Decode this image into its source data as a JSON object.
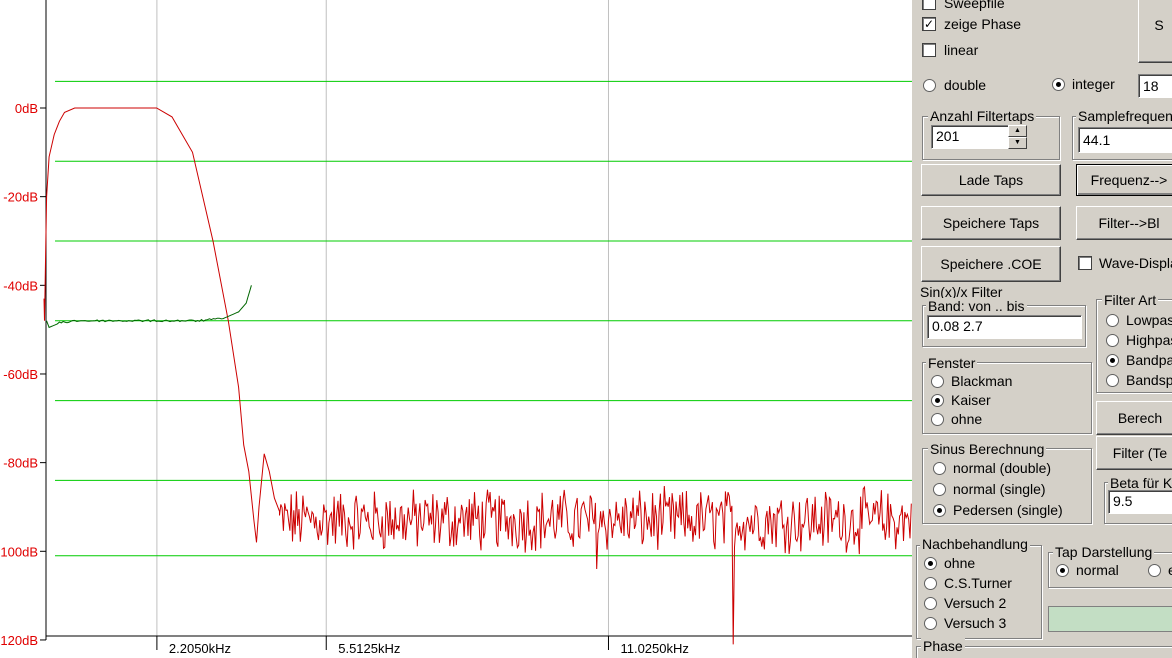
{
  "chart_data": {
    "type": "line",
    "y_axis": {
      "unit": "dB",
      "ylim": [
        -120,
        10
      ],
      "tick_values": [
        0,
        -20,
        -40,
        -60,
        -80,
        -100,
        -120
      ],
      "tick_labels": [
        "0dB",
        "-20dB",
        "-40dB",
        "-60dB",
        "-80dB",
        "-100dB",
        "-120dB"
      ]
    },
    "x_axis": {
      "unit": "kHz",
      "xlim": [
        0,
        22.05
      ],
      "tick_values": [
        2.205,
        5.5125,
        11.025
      ],
      "tick_labels": [
        "2.2050kHz",
        "5.5125kHz",
        "11.0250kHz"
      ]
    },
    "hgrid_db": [
      6,
      -12,
      -30,
      -48,
      -66,
      -84,
      -101
    ],
    "series": [
      {
        "color": "#cc0000",
        "role": "magnitude",
        "x": [
          0,
          0.01,
          0.05,
          0.1,
          0.2,
          0.3,
          0.4,
          0.6,
          2.2,
          2.5,
          2.9,
          3.3,
          3.6,
          3.8,
          3.9,
          4.0,
          4.1,
          4.15,
          4.2,
          4.3,
          4.4,
          4.5,
          4.6
        ],
        "y": [
          -43,
          -48,
          -20,
          -11,
          -6,
          -3,
          -1,
          0,
          0,
          -2,
          -10,
          -30,
          -48,
          -63,
          -76,
          -82,
          -93,
          -98,
          -90,
          -78,
          -82,
          -88,
          -91
        ],
        "noise_floor": {
          "from": 4.6,
          "to": 22.05,
          "mean_db": -93,
          "min_db": -104,
          "max_db": -84,
          "spikes": [
            {
              "x": 13.45,
              "y": -121
            },
            {
              "x": 10.8,
              "y": -104
            }
          ]
        }
      },
      {
        "color": "#006600",
        "role": "phase",
        "x": [
          0.05,
          0.1,
          0.3,
          0.6,
          1.0,
          2.0,
          3.0,
          3.5,
          3.8,
          3.95,
          4.05
        ],
        "y": [
          -48,
          -49.5,
          -48.5,
          -48,
          -48,
          -48,
          -48,
          -47.5,
          -46,
          -44,
          -40
        ]
      }
    ]
  },
  "panel": {
    "sweepfile": {
      "label": "Sweepfile",
      "checked": false
    },
    "zeige_phase": {
      "label": "zeige Phase",
      "checked": true
    },
    "linear": {
      "label": "linear",
      "checked": false
    },
    "top_button_label": "S",
    "double": {
      "label": "double",
      "selected": false
    },
    "integer": {
      "label": "integer",
      "selected": true
    },
    "bits_value": "18",
    "filtertaps": {
      "title": "Anzahl Filtertaps",
      "value": "201"
    },
    "samplefreq": {
      "title": "Samplefrequenz",
      "value": "44.1"
    },
    "lade_taps": "Lade Taps",
    "frequenz_button": "Frequenz-->",
    "speichere_taps": "Speichere Taps",
    "filter_bl": "Filter-->Bl",
    "speichere_coe": "Speichere .COE",
    "wave_display": {
      "label": "Wave-Displa",
      "checked": false
    },
    "sinx_title": "Sin(x)/x Filter",
    "band": {
      "title": "Band: von .. bis",
      "value": "0.08  2.7"
    },
    "filter_art": {
      "title": "Filter Art",
      "options": [
        "Lowpas",
        "Highpas",
        "Bandpa",
        "Bandsp"
      ],
      "selected": 2
    },
    "fenster": {
      "title": "Fenster",
      "options": [
        "Blackman",
        "Kaiser",
        "ohne"
      ],
      "selected": 1
    },
    "berech_button": "Berech",
    "sinus": {
      "title": "Sinus Berechnung",
      "options": [
        "normal (double)",
        "normal (single)",
        "Pedersen (single)"
      ],
      "selected": 2
    },
    "filter_te_button": "Filter (Te",
    "beta": {
      "title": "Beta für Ka",
      "value": "9.5"
    },
    "nachbehandlung": {
      "title": "Nachbehandlung",
      "options": [
        "ohne",
        "C.S.Turner",
        "Versuch 2",
        "Versuch 3"
      ],
      "selected": 0
    },
    "tap_darstellung": {
      "title": "Tap Darstellung",
      "options": [
        "normal",
        "e"
      ],
      "selected": 0
    },
    "phase_title": "Phase",
    "colors": {
      "panel_bg": "#d4d0c8",
      "progress": "#c3dec4",
      "magnitude": "#cc0000",
      "phase": "#006600",
      "grid_h": "#00cc00",
      "grid_v": "#c0c0c0"
    }
  }
}
